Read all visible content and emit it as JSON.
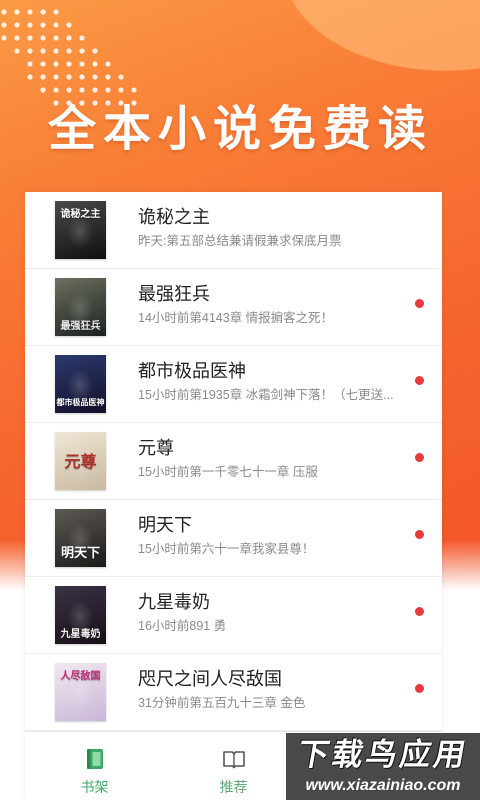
{
  "headline": "全本小说免费读",
  "books": [
    {
      "title": "诡秘之主",
      "update": "昨天:第五部总结兼请假兼求保底月票",
      "unread": false,
      "cover_text": "诡秘之主",
      "cover_text_color": "#ffffff",
      "cover_colors": [
        "#4a4a4a",
        "#0f0f10"
      ]
    },
    {
      "title": "最强狂兵",
      "update": "14小时前第4143章 情报掮客之死！",
      "unread": true,
      "cover_text": "最强狂兵",
      "cover_text_color": "#e8e8e8",
      "cover_colors": [
        "#6b7060",
        "#1d2220"
      ]
    },
    {
      "title": "都市极品医神",
      "update": "15小时前第1935章 冰霜剑神下落！（七更送...",
      "unread": true,
      "cover_text": "都市极品医神",
      "cover_text_color": "#ffffff",
      "cover_colors": [
        "#2b3a6e",
        "#140f2a"
      ]
    },
    {
      "title": "元尊",
      "update": "15小时前第一千零七十一章 压服",
      "unread": true,
      "cover_text": "元尊",
      "cover_text_color": "#b0302a",
      "cover_colors": [
        "#efe7d6",
        "#c9b9a0"
      ]
    },
    {
      "title": "明天下",
      "update": "15小时前第六十一章我家县尊！",
      "unread": true,
      "cover_text": "明天下",
      "cover_text_color": "#ffffff",
      "cover_colors": [
        "#5d5a55",
        "#1c1a18"
      ]
    },
    {
      "title": "九星毒奶",
      "update": "16小时前891 勇",
      "unread": true,
      "cover_text": "九星毒奶",
      "cover_text_color": "#f0f0f0",
      "cover_colors": [
        "#3a3346",
        "#180f16"
      ]
    },
    {
      "title": "咫尺之间人尽敌国",
      "update": "31分钟前第五百九十三章 金色",
      "unread": true,
      "cover_text": "人尽敌国",
      "cover_text_color": "#c0307a",
      "cover_colors": [
        "#f3e8f0",
        "#c8b7d8"
      ]
    }
  ],
  "tabs": [
    {
      "label": "书架",
      "icon": "bookshelf-icon",
      "active": true
    },
    {
      "label": "推荐",
      "icon": "open-book-icon",
      "active": false
    }
  ],
  "watermark": {
    "brand": "下载鸟应用",
    "url": "www.xiazainiao.com"
  },
  "colors": {
    "accent": "#f6652f",
    "unread_dot": "#e8393d",
    "tab_active": "#3da967",
    "tab_inactive": "#5fa878",
    "title_text": "#222222",
    "subtitle_text": "#8a8a8a"
  }
}
